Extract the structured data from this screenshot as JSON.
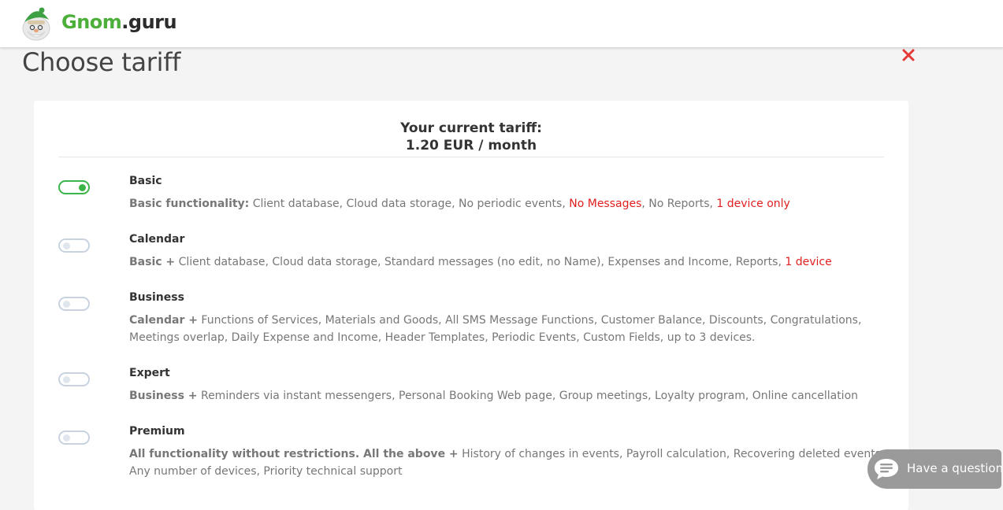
{
  "brand": {
    "part1": "Gnom",
    "part2": ".guru"
  },
  "page": {
    "title": "Choose tariff"
  },
  "current": {
    "line1": "Your current tariff:",
    "line2": "1.20 EUR / month"
  },
  "tariffs": [
    {
      "name": "Basic",
      "selected": true,
      "prefix": "Basic functionality:",
      "parts": [
        {
          "text": "Client database, Cloud data storage, No periodic events, ",
          "highlight": false
        },
        {
          "text": "No Messages",
          "highlight": true
        },
        {
          "text": ", No Reports, ",
          "highlight": false
        },
        {
          "text": "1 device only",
          "highlight": true
        }
      ]
    },
    {
      "name": "Calendar",
      "selected": false,
      "prefix": "Basic +",
      "parts": [
        {
          "text": "Client database, Cloud data storage, Standard messages (no edit, no Name), Expenses and Income, Reports, ",
          "highlight": false
        },
        {
          "text": "1 device",
          "highlight": true
        }
      ]
    },
    {
      "name": "Business",
      "selected": false,
      "prefix": "Calendar +",
      "parts": [
        {
          "text": "Functions of Services, Materials and Goods, All SMS Message Functions, Customer Balance, Discounts, Congratulations, Meetings overlap, Daily Expense and Income, Header Templates, Periodic Events, Custom Fields, up to 3 devices.",
          "highlight": false
        }
      ]
    },
    {
      "name": "Expert",
      "selected": false,
      "prefix": "Business +",
      "parts": [
        {
          "text": "Reminders via instant messengers, Personal Booking Web page, Group meetings, Loyalty program, Online cancellation",
          "highlight": false
        }
      ]
    },
    {
      "name": "Premium",
      "selected": false,
      "prefix": "All functionality without restrictions. All the above +",
      "parts": [
        {
          "text": "History of changes in events, Payroll calculation, Recovering deleted events, Any number of devices, Priority technical support",
          "highlight": false
        }
      ]
    }
  ],
  "chat": {
    "label": "Have a question?"
  },
  "colors": {
    "accent": "#3bb54a",
    "highlight": "#e02020",
    "close": "#e53935",
    "brand_green": "#4caf3a"
  },
  "icons": {
    "close": "close-icon",
    "chat": "chat-bubble-icon",
    "logo": "gnome-logo-icon"
  }
}
